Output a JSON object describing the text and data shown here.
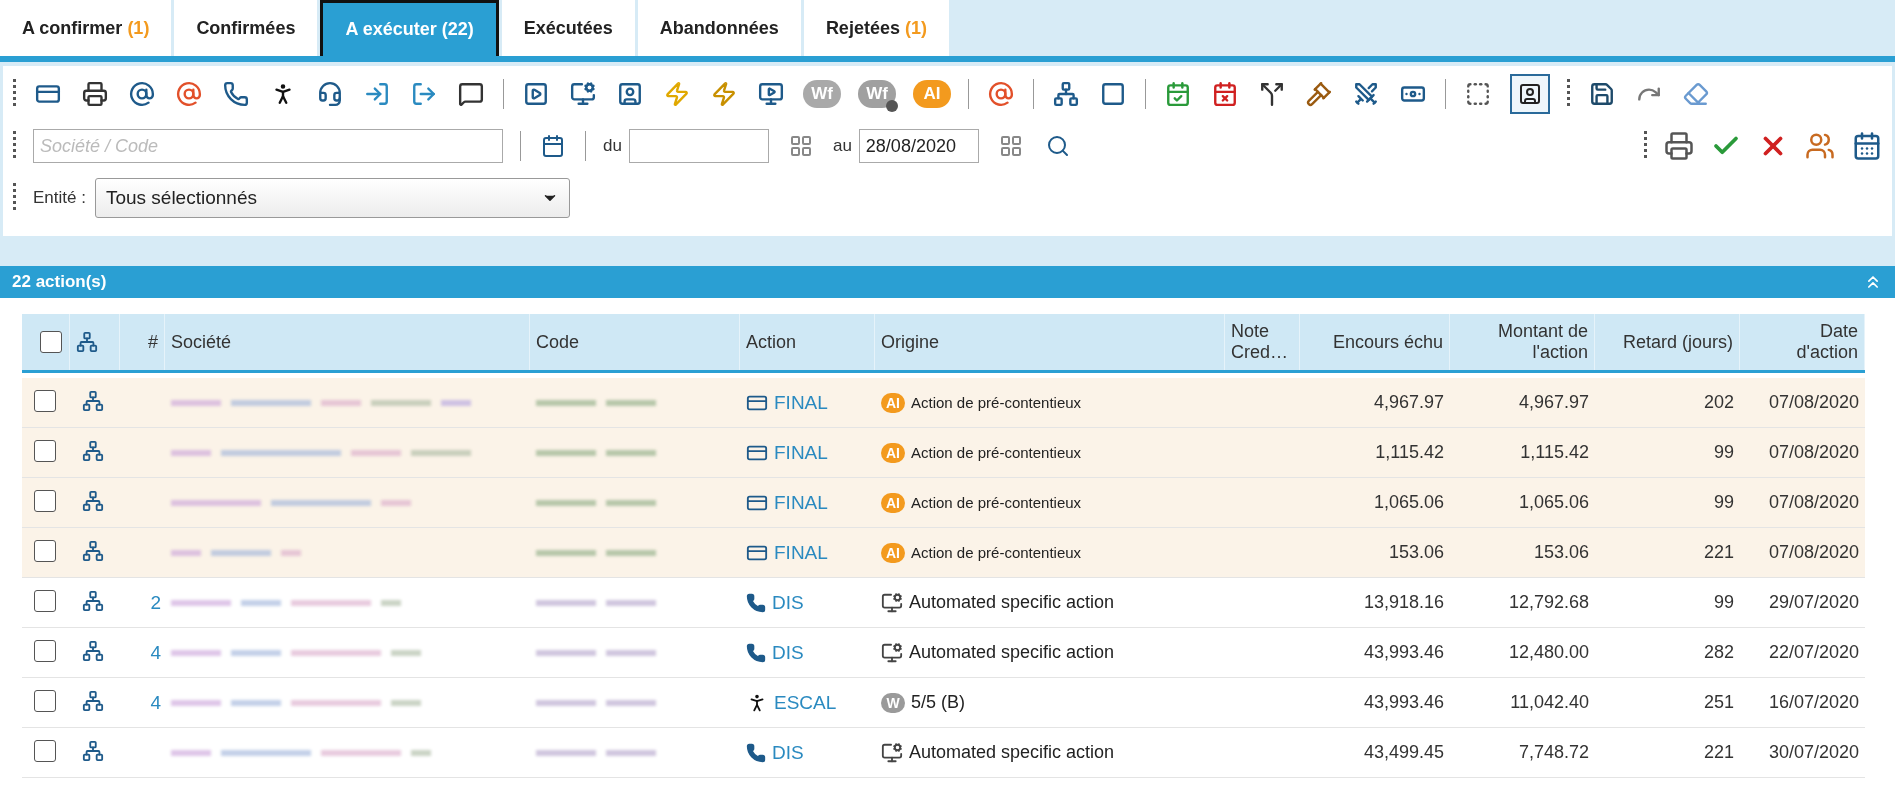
{
  "tabs": [
    {
      "label": "A confirmer",
      "count": "(1)",
      "selected": false
    },
    {
      "label": "Confirmées",
      "selected": false
    },
    {
      "label": "A exécuter (22)",
      "selected": true
    },
    {
      "label": "Exécutées",
      "selected": false
    },
    {
      "label": "Abandonnées",
      "selected": false
    },
    {
      "label": "Rejetées",
      "count": "(1)",
      "selected": false
    }
  ],
  "toolbar": {
    "badges": [
      {
        "text": "Wf",
        "paused": false,
        "color": "#a9a9a9"
      },
      {
        "text": "Wf",
        "paused": true,
        "color": "#a0a0a0"
      },
      {
        "text": "AI",
        "paused": false,
        "color": "#f39a1e"
      }
    ],
    "assign_toggle_pressed": true,
    "search": {
      "placeholder": "Société / Code"
    },
    "from_label": "du",
    "to_label": "au",
    "to_value": "28/08/2020",
    "entity_label": "Entité :",
    "entity_value": "Tous sélectionnés"
  },
  "section": {
    "title": "22 action(s)",
    "expanded": true
  },
  "table": {
    "all_checked": false,
    "columns": [
      "#",
      "Société",
      "Code",
      "Action",
      "Origine",
      "Note Cred…",
      "Encours échu",
      "Montant de l'action",
      "Retard (jours)",
      "Date d'action"
    ],
    "rows": [
      {
        "highlighted": true,
        "checked": false,
        "action": {
          "kind": "letter",
          "label": "FINAL"
        },
        "origin": {
          "kind": "ai",
          "badge": "AI",
          "text": "Action de pré-contentieux"
        },
        "encours": "4,967.97",
        "montant": "4,967.97",
        "retard": "202",
        "date": "07/08/2020"
      },
      {
        "highlighted": true,
        "checked": false,
        "action": {
          "kind": "letter",
          "label": "FINAL"
        },
        "origin": {
          "kind": "ai",
          "badge": "AI",
          "text": "Action de pré-contentieux"
        },
        "encours": "1,115.42",
        "montant": "1,115.42",
        "retard": "99",
        "date": "07/08/2020"
      },
      {
        "highlighted": true,
        "checked": false,
        "action": {
          "kind": "letter",
          "label": "FINAL"
        },
        "origin": {
          "kind": "ai",
          "badge": "AI",
          "text": "Action de pré-contentieux"
        },
        "encours": "1,065.06",
        "montant": "1,065.06",
        "retard": "99",
        "date": "07/08/2020"
      },
      {
        "highlighted": true,
        "checked": false,
        "action": {
          "kind": "letter",
          "label": "FINAL"
        },
        "origin": {
          "kind": "ai",
          "badge": "AI",
          "text": "Action de pré-contentieux"
        },
        "encours": "153.06",
        "montant": "153.06",
        "retard": "221",
        "date": "07/08/2020"
      },
      {
        "highlighted": false,
        "checked": false,
        "number": "2",
        "action": {
          "kind": "phone",
          "label": "DIS"
        },
        "origin": {
          "kind": "auto",
          "text": "Automated specific action"
        },
        "encours": "13,918.16",
        "montant": "12,792.68",
        "retard": "99",
        "date": "29/07/2020"
      },
      {
        "highlighted": false,
        "checked": false,
        "number": "4",
        "action": {
          "kind": "phone",
          "label": "DIS"
        },
        "origin": {
          "kind": "auto",
          "text": "Automated specific action"
        },
        "encours": "43,993.46",
        "montant": "12,480.00",
        "retard": "282",
        "date": "22/07/2020"
      },
      {
        "highlighted": false,
        "checked": false,
        "number": "4",
        "action": {
          "kind": "walk",
          "label": "ESCAL"
        },
        "origin": {
          "kind": "wf",
          "badge": "W",
          "text": "5/5 (B)"
        },
        "encours": "43,993.46",
        "montant": "11,042.40",
        "retard": "251",
        "date": "16/07/2020"
      },
      {
        "highlighted": false,
        "checked": false,
        "action": {
          "kind": "phone",
          "label": "DIS"
        },
        "origin": {
          "kind": "auto",
          "text": "Automated specific action"
        },
        "encours": "43,499.45",
        "montant": "7,748.72",
        "retard": "221",
        "date": "30/07/2020"
      }
    ]
  }
}
